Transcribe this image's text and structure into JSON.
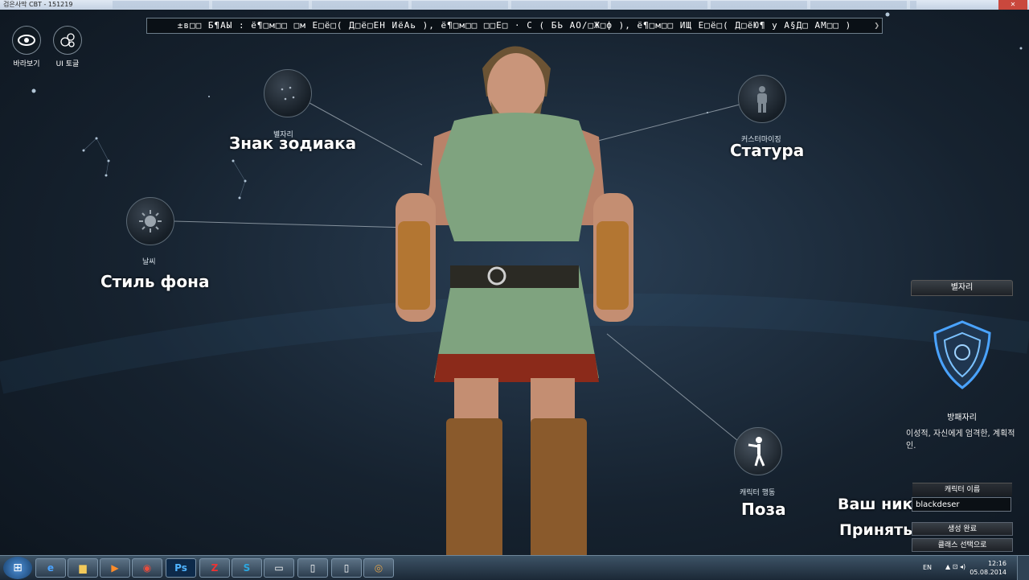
{
  "window": {
    "title": "검은사막 CBT - 151219"
  },
  "top_message": "±в□□ Б¶АЫ : ё¶□м□□ □м Е□ё□( Д□ё□ЕН ИёАь ), ё¶□м□□ □□Е□ · С ( БЬ АО/□Ж□ф ), ё¶□м□□ ИЩ Е□ё□( Д□ёЮ¶ у А§Д□ АМ□□ )",
  "corner_buttons": [
    {
      "label": "바라보기",
      "icon": "eye-icon"
    },
    {
      "label": "UI 토글",
      "icon": "bubbles-icon"
    }
  ],
  "nodes": {
    "zodiac": {
      "small": "별자리",
      "big": "Знак зодиака",
      "icon": "constellation-icon"
    },
    "background": {
      "small": "날씨",
      "big": "Стиль фона",
      "icon": "sun-icon"
    },
    "stature": {
      "small": "커스터마이징",
      "big": "Статура",
      "icon": "person-icon"
    },
    "pose": {
      "small": "캐릭터 행동",
      "big": "Поза",
      "icon": "pointing-person-icon"
    }
  },
  "side_panel": {
    "header": "별자리",
    "emblem": "shield-emblem-icon",
    "sign_name": "방패자리",
    "description": "이성적, 자신에게 엄격한, 계획적인."
  },
  "name_panel": {
    "header": "캐릭터 이름",
    "input_value": "blackdeser",
    "nick_label": "Ваш ник",
    "accept_label": "Принять",
    "create_button": "생성 완료",
    "class_button": "클래스 선택으로"
  },
  "taskbar": {
    "apps": [
      "ie-icon",
      "folder-icon",
      "media-player-icon",
      "chrome-icon",
      "photoshop-icon",
      "filezilla-icon",
      "skype-icon",
      "terminal-icon",
      "window-icon",
      "window-icon",
      "game-icon"
    ],
    "ps_text": "Ps",
    "lang": "EN",
    "time": "12:16",
    "date": "05.08.2014"
  },
  "colors": {
    "background": "#16222f",
    "accent": "#4aa3ff"
  }
}
